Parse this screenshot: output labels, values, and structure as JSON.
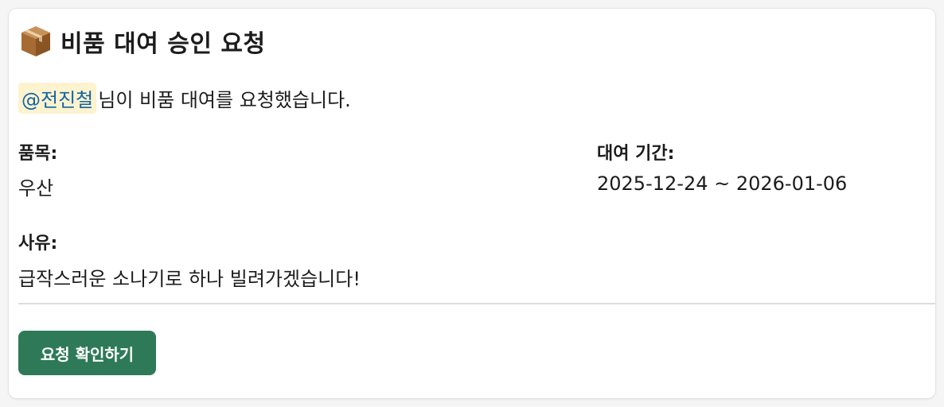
{
  "message": {
    "icon": "package-box-icon",
    "title": "비품 대여 승인 요청",
    "mention": "@전진철",
    "intro_text": "님이 비품 대여를 요청했습니다."
  },
  "fields": {
    "item": {
      "label": "품목:",
      "value": "우산"
    },
    "period": {
      "label": "대여 기간:",
      "value": "2025-12-24 ~ 2026-01-06"
    },
    "reason": {
      "label": "사유:",
      "value": "급작스러운 소나기로 하나 빌려가겠습니다!"
    }
  },
  "actions": {
    "confirm_label": "요청 확인하기"
  },
  "colors": {
    "button_bg": "#2e7a58",
    "mention_bg": "#fdf3cf",
    "mention_text": "#1264a3"
  }
}
